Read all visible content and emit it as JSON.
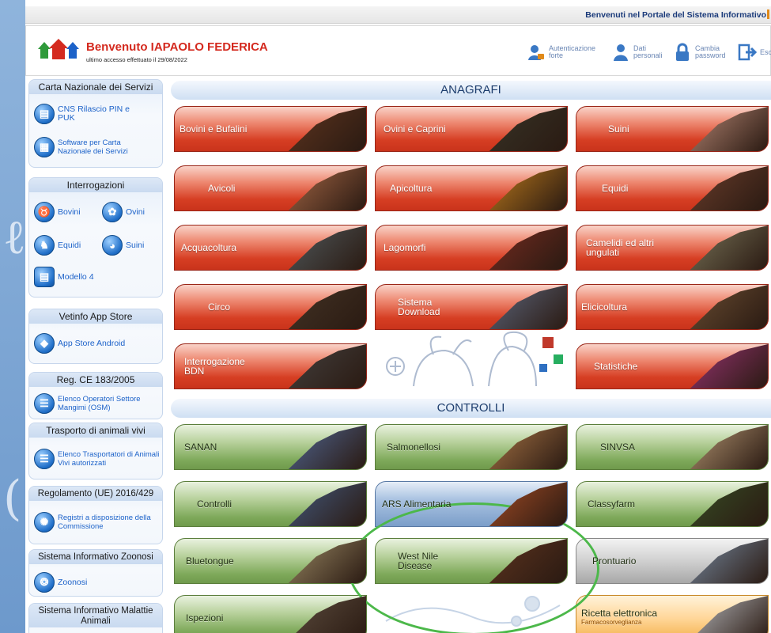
{
  "topbar": {
    "text": "Benvenuti nel Portale del Sistema Informativo"
  },
  "header": {
    "welcome": "Benvenuto IAPAOLO FEDERICA",
    "last_access": "ultimo accesso effettuato il 29/08/2022",
    "buttons": [
      {
        "label": "Autenticazione forte",
        "icon": "lock-user-icon"
      },
      {
        "label": "Dati personali",
        "icon": "user-icon"
      },
      {
        "label": "Cambia password",
        "icon": "padlock-icon"
      },
      {
        "label": "Esc",
        "icon": "exit-icon"
      }
    ]
  },
  "sidebar": {
    "cns": {
      "title": "Carta Nazionale dei Servizi",
      "items": [
        {
          "label": "CNS Rilascio PIN e PUK",
          "icon": "card-icon"
        },
        {
          "label": "Software per Carta Nazionale dei Servizi",
          "icon": "software-icon"
        }
      ]
    },
    "interrogazioni": {
      "title": "Interrogazioni",
      "items": [
        {
          "label": "Bovini",
          "icon": "cow-icon"
        },
        {
          "label": "Ovini",
          "icon": "sheep-icon"
        },
        {
          "label": "Equidi",
          "icon": "horse-icon"
        },
        {
          "label": "Suini",
          "icon": "pig-icon"
        },
        {
          "label": "Modello 4",
          "icon": "document-icon"
        }
      ]
    },
    "appstore": {
      "title": "Vetinfo App Store",
      "items": [
        {
          "label": "App Store Android",
          "icon": "android-icon"
        }
      ]
    },
    "reg183": {
      "title": "Reg. CE 183/2005",
      "items": [
        {
          "label": "Elenco Operatori Settore Mangimi (OSM)",
          "icon": "list-icon"
        }
      ]
    },
    "trasporto": {
      "title": "Trasporto di animali vivi",
      "items": [
        {
          "label": "Elenco Trasportatori di Animali Vivi autorizzati",
          "icon": "list-icon"
        }
      ]
    },
    "reg2016": {
      "title": "Regolamento (UE) 2016/429",
      "items": [
        {
          "label": "Registri a disposizione della Commissione",
          "icon": "eu-icon"
        }
      ]
    },
    "zoonosi": {
      "title": "Sistema Informativo Zoonosi",
      "items": [
        {
          "label": "Zoonosi",
          "icon": "zoonosi-icon"
        }
      ]
    },
    "malattie": {
      "title": "Sistema Informativo Malattie Animali"
    }
  },
  "main": {
    "anagrafi": {
      "title": "ANAGRAFI",
      "tiles": [
        {
          "label": "Bovini e Bufalini",
          "photo": "#6b3b22"
        },
        {
          "label": "Ovini e Caprini",
          "photo": "#3a3a2c"
        },
        {
          "label": "Suini",
          "photo": "#d9a28d"
        },
        {
          "label": "Avicoli",
          "photo": "#c47a52"
        },
        {
          "label": "Apicoltura",
          "photo": "#e1921e"
        },
        {
          "label": "Equidi",
          "photo": "#7a4632"
        },
        {
          "label": "Acquacoltura",
          "photo": "#5a6a70"
        },
        {
          "label": "Lagomorfi",
          "photo": "#8a3024"
        },
        {
          "label": "Camelidi ed altri ungulati",
          "photo": "#8c8a6a"
        },
        {
          "label": "Circo",
          "photo": "#4a3a2a"
        },
        {
          "label": "Sistema Download",
          "photo": "#6a7a98"
        },
        {
          "label": "Elicicoltura",
          "photo": "#7a5a3a"
        },
        {
          "label": "Interrogazione BDN",
          "photo": "#4a4a4a"
        },
        {
          "label": "Statistiche",
          "photo": "#b43a8a"
        }
      ]
    },
    "controlli": {
      "title": "CONTROLLI",
      "tiles": [
        {
          "label": "SANAN",
          "photo": "#5a7ab4"
        },
        {
          "label": "Salmonellosi",
          "photo": "#c78a52"
        },
        {
          "label": "SINVSA",
          "photo": "#d6b48a"
        },
        {
          "label": "Controlli",
          "photo": "#4a6a9a"
        },
        {
          "label": "ARS Alimentaria",
          "photo": "#c2582a"
        },
        {
          "label": "Classyfarm",
          "photo": "#3a5a2a"
        },
        {
          "label": "Bluetongue",
          "photo": "#b6a478"
        },
        {
          "label": "West Nile Disease",
          "photo": "#6a3a22"
        },
        {
          "label": "Prontuario",
          "photo": "#8aa6c4"
        },
        {
          "label": "Ispezioni",
          "photo": "#6a5a4a"
        },
        {
          "label": "Ricetta elettronica",
          "sub": "Farmacosorveglianza",
          "photo": "#dfe6ee"
        }
      ]
    }
  }
}
